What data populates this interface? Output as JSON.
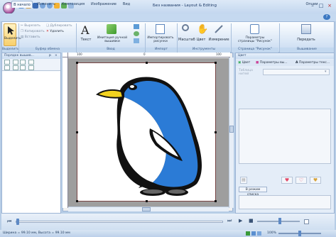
{
  "window": {
    "title": "Без названия - Layout & Editing",
    "minimize": "–",
    "maximize": "□",
    "close": "×"
  },
  "tabs": [
    {
      "label": "В начало",
      "active": true
    },
    {
      "label": "Изменить"
    },
    {
      "label": "Композиция"
    },
    {
      "label": "Изображение"
    },
    {
      "label": "Вид"
    }
  ],
  "top_right": {
    "options": "Опции",
    "help": "?"
  },
  "ribbon": {
    "select": "Выделить",
    "cut": "Вырезать",
    "copy": "Копировать",
    "paste": "Вставить",
    "duplicate": "Дублировать",
    "delete": "Удалить",
    "text": "Текст",
    "hand_embroidery": "Имитация ручной вышивки",
    "import_pictures": "Импортировать рисунки",
    "zoom": "Масштаб",
    "color": "Цвет",
    "measure": "Измерение",
    "page_params": "Параметры страницы \"Рисунок\"",
    "transfer": "Передать",
    "groups": [
      "Выделить",
      "Буфер обмена",
      "Ввод",
      "Импорт",
      "Инструменты",
      "Страница \"Рисунок\"",
      "Вышивание"
    ]
  },
  "left_panel": {
    "title": "Порядок вышив...",
    "pin": "ᵽ",
    "close": "×"
  },
  "ruler": {
    "marks": [
      "100",
      "0",
      "100"
    ]
  },
  "right_panel": {
    "title": "Цвет",
    "tabs": [
      "Цвет",
      "Параметры вы...",
      "Параметры текс..."
    ],
    "thread_chart_label": "Таблица нитей",
    "sew_mode_button": "В режим списка"
  },
  "status": {
    "dimensions": "Ширина = 99.10 мм, Высота = 99.10 мм",
    "zoom": "100%"
  },
  "colors": {
    "accent": "#2b7bd6",
    "ribbon": "#dfeaf7",
    "beak": "#f2d21f"
  }
}
